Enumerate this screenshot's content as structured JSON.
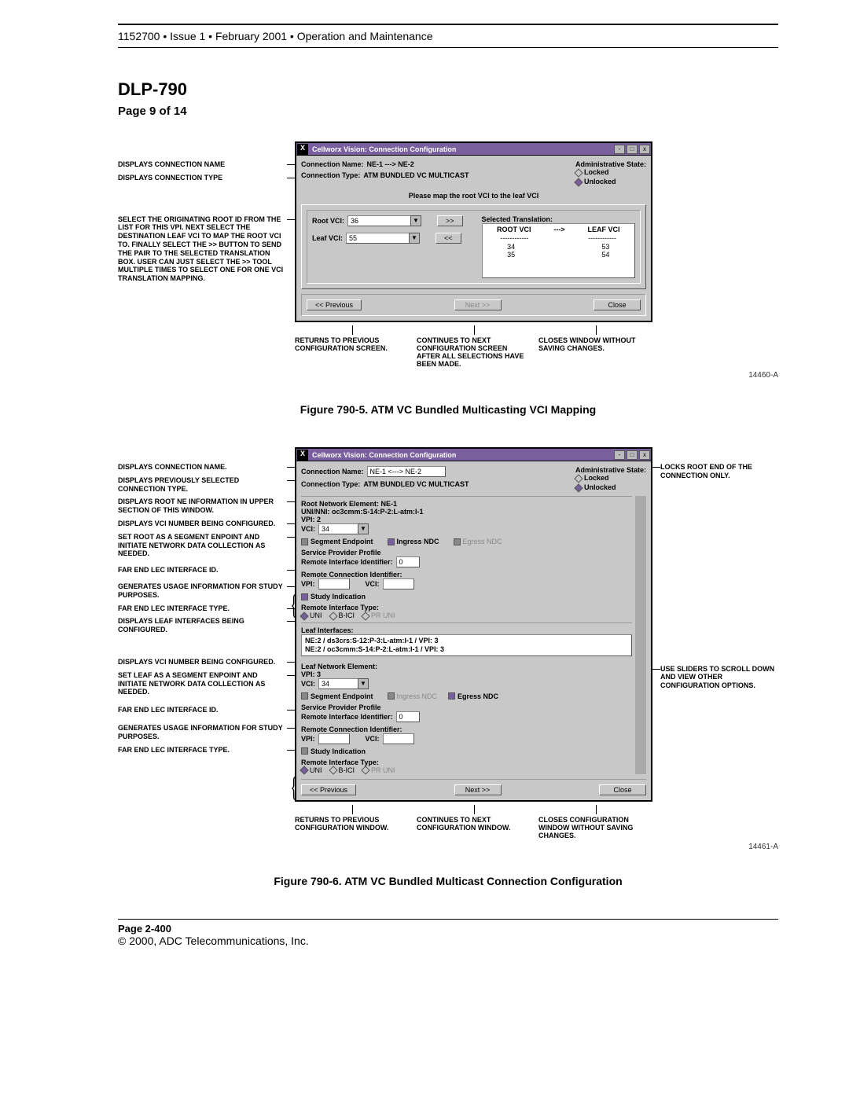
{
  "header": {
    "line": "1152700 • Issue 1 • February 2001 • Operation and Maintenance"
  },
  "title": "DLP-790",
  "subtitle": "Page 9 of 14",
  "fig1": {
    "callouts_left": {
      "c1": "DISPLAYS CONNECTION NAME",
      "c2": "DISPLAYS CONNECTION TYPE",
      "c3": "SELECT THE ORIGINATING ROOT ID FROM THE LIST FOR THIS VPI. NEXT SELECT THE DESTINATION LEAF VCI TO MAP THE ROOT VCI TO. FINALLY SELECT THE >> BUTTON TO SEND THE PAIR TO THE SELECTED TRANSLATION BOX. USER CAN JUST SELECT THE >> TOOL MULTIPLE TIMES TO SELECT ONE FOR ONE VCI TRANSLATION MAPPING."
    },
    "window": {
      "title": "Cellworx Vision:  Connection Configuration",
      "conn_name_label": "Connection Name:",
      "conn_name_value": "NE-1 ---> NE-2",
      "conn_type_label": "Connection Type:",
      "conn_type_value": "ATM BUNDLED VC MULTICAST",
      "admin_label": "Administrative State:",
      "admin_locked": "Locked",
      "admin_unlocked": "Unlocked",
      "instruction": "Please map the root VCI to the leaf VCI",
      "root_vci_label": "Root VCI:",
      "root_vci_value": "36",
      "leaf_vci_label": "Leaf VCI:",
      "leaf_vci_value": "55",
      "to_right": ">>",
      "to_left": "<<",
      "sel_trans_label": "Selected Translation:",
      "sel_head_root": "ROOT VCI",
      "sel_head_arrow": " ---> ",
      "sel_head_leaf": "LEAF VCI",
      "sel_dash": "------------",
      "sel_r1_a": "34",
      "sel_r1_b": "53",
      "sel_r2_a": "35",
      "sel_r2_b": "54",
      "prev": "<< Previous",
      "next": "Next >>",
      "close": "Close"
    },
    "below": {
      "b1": "RETURNS TO PREVIOUS CONFIGURATION SCREEN.",
      "b2": "CONTINUES TO NEXT CONFIGURATION SCREEN AFTER ALL SELECTIONS HAVE BEEN MADE.",
      "b3": "CLOSES WINDOW WITHOUT SAVING CHANGES."
    },
    "fignum": "14460-A",
    "caption": "Figure 790-5. ATM VC Bundled Multicasting VCI Mapping"
  },
  "fig2": {
    "callouts_left": {
      "c1": "DISPLAYS CONNECTION NAME.",
      "c2": "DISPLAYS PREVIOUSLY SELECTED CONNECTION TYPE.",
      "c3": "DISPLAYS ROOT NE INFORMATION IN UPPER SECTION OF THIS WINDOW.",
      "c4": "DISPLAYS VCI NUMBER BEING CONFIGURED.",
      "c5": "SET ROOT AS A SEGMENT ENPOINT AND INITIATE NETWORK DATA COLLECTION AS NEEDED.",
      "c6": "FAR END LEC INTERFACE ID.",
      "c7": "GENERATES USAGE INFORMATION FOR STUDY PURPOSES.",
      "c8": "FAR END LEC INTERFACE TYPE.",
      "c9": "DISPLAYS LEAF INTERFACES BEING CONFIGURED.",
      "c10": "DISPLAYS VCI NUMBER BEING CONFIGURED.",
      "c11": "SET LEAF AS A SEGMENT ENPOINT AND INITIATE NETWORK DATA COLLECTION AS NEEDED.",
      "c12": "FAR END LEC INTERFACE ID.",
      "c13": "GENERATES USAGE INFORMATION FOR STUDY PURPOSES.",
      "c14": "FAR END LEC INTERFACE TYPE."
    },
    "callouts_right": {
      "r1": "LOCKS ROOT END OF THE CONNECTION ONLY.",
      "r2": "USE SLIDERS TO SCROLL DOWN AND VIEW OTHER CONFIGURATION OPTIONS."
    },
    "window": {
      "title": "Cellworx Vision: Connection Configuration",
      "conn_name_label": "Connection Name:",
      "conn_name_value": "NE-1 <---> NE-2",
      "conn_type_label": "Connection Type:",
      "conn_type_value": "ATM BUNDLED VC MULTICAST",
      "admin_label": "Administrative State:",
      "admin_locked": "Locked",
      "admin_unlocked": "Unlocked",
      "root_ne_label": "Root Network Element:  NE-1",
      "uni_nni_label": "UNI/NNI:  oc3cmm:S-14:P-2:L-atm:I-1",
      "vpi2": "VPI:  2",
      "vci_label": "VCI:",
      "vci_val": "34",
      "seg_ep": "Segment Endpoint",
      "ingress": "Ingress NDC",
      "egress": "Egress NDC",
      "spp": "Service Provider Profile",
      "rii_label": "Remote Interface Identifier:",
      "rii_value": "0",
      "rci_label": "Remote Connection Identifier:",
      "vpi_in": "VPI:",
      "vci_in": "VCI:",
      "study": "Study Indication",
      "rit": "Remote Interface Type:",
      "uni": "UNI",
      "bici": "B-ICI",
      "pruni": "PR UNI",
      "leaf_if_label": "Leaf Interfaces:",
      "leaf_if_1": "NE:2 / ds3crs:S-12:P-3:L-atm:I-1 / VPI: 3",
      "leaf_if_2": "NE:2 / oc3cmm:S-14:P-2:L-atm:I-1 / VPI: 3",
      "leaf_ne_label": "Leaf Network Element:",
      "vpi3": "VPI:  3",
      "prev": "<< Previous",
      "next": "Next >>",
      "close": "Close"
    },
    "below": {
      "b1": "RETURNS TO PREVIOUS CONFIGURATION WINDOW.",
      "b2": "CONTINUES TO NEXT CONFIGURATION WINDOW.",
      "b3": "CLOSES CONFIGURATION WINDOW WITHOUT SAVING CHANGES."
    },
    "fignum": "14461-A",
    "caption": "Figure 790-6. ATM VC Bundled Multicast Connection Configuration"
  },
  "footer": {
    "l1": "Page 2-400",
    "l2": "© 2000, ADC Telecommunications, Inc."
  }
}
